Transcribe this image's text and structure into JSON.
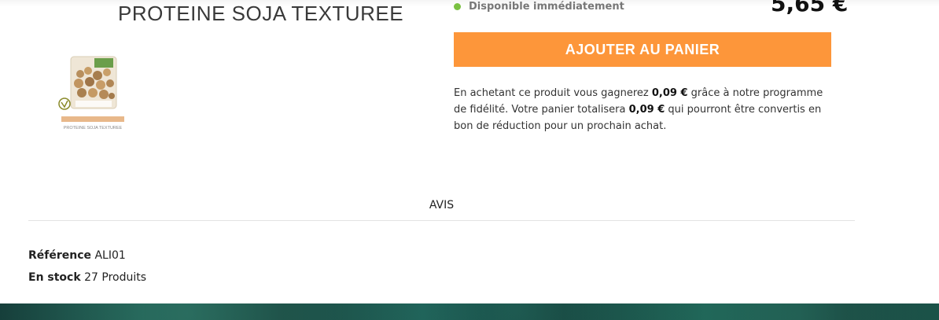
{
  "product": {
    "title": "PROTEINE SOJA TEXTUREE",
    "thumbnail_caption": "PROTEINE SOJA TEXTUREE",
    "availability": "Disponible immédiatement",
    "price": "5,65 €"
  },
  "cart": {
    "add_label": "AJOUTER AU PANIER"
  },
  "loyalty": {
    "text_1": "En achetant ce produit vous gagnerez ",
    "points_1": "0,09 €",
    "text_2": " grâce à notre programme de fidélité. Votre panier totalisera ",
    "points_2": "0,09 €",
    "text_3": " qui pourront être convertis en bon de réduction pour un prochain achat."
  },
  "tabs": {
    "avis": "AVIS"
  },
  "details": {
    "reference_label": "Référence",
    "reference_value": "ALI01",
    "stock_label": "En stock",
    "stock_value": "27 Produits"
  },
  "colors": {
    "accent": "#fd963a",
    "available": "#7ac142"
  }
}
